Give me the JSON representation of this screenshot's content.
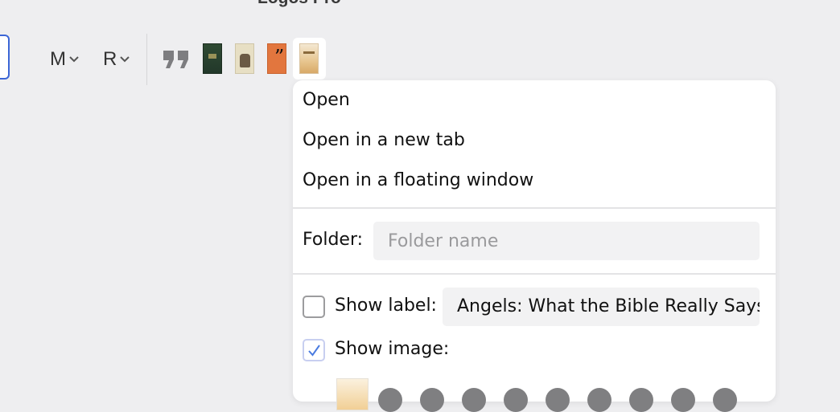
{
  "app": {
    "title": "Logos Pro"
  },
  "toolbar": {
    "menus": [
      {
        "label": "M"
      },
      {
        "label": "R"
      }
    ]
  },
  "popup": {
    "items": [
      {
        "label": "Open"
      },
      {
        "label": "Open in a new tab"
      },
      {
        "label": "Open in a floating window"
      }
    ],
    "folder": {
      "label": "Folder:",
      "placeholder": "Folder name",
      "value": ""
    },
    "show_label": {
      "label": "Show label:",
      "checked": false,
      "value": "Angels: What the Bible Really Says"
    },
    "show_image": {
      "label": "Show image:",
      "checked": true
    }
  },
  "colors": {
    "accent": "#3c66d6",
    "check": "#4a7be0"
  }
}
